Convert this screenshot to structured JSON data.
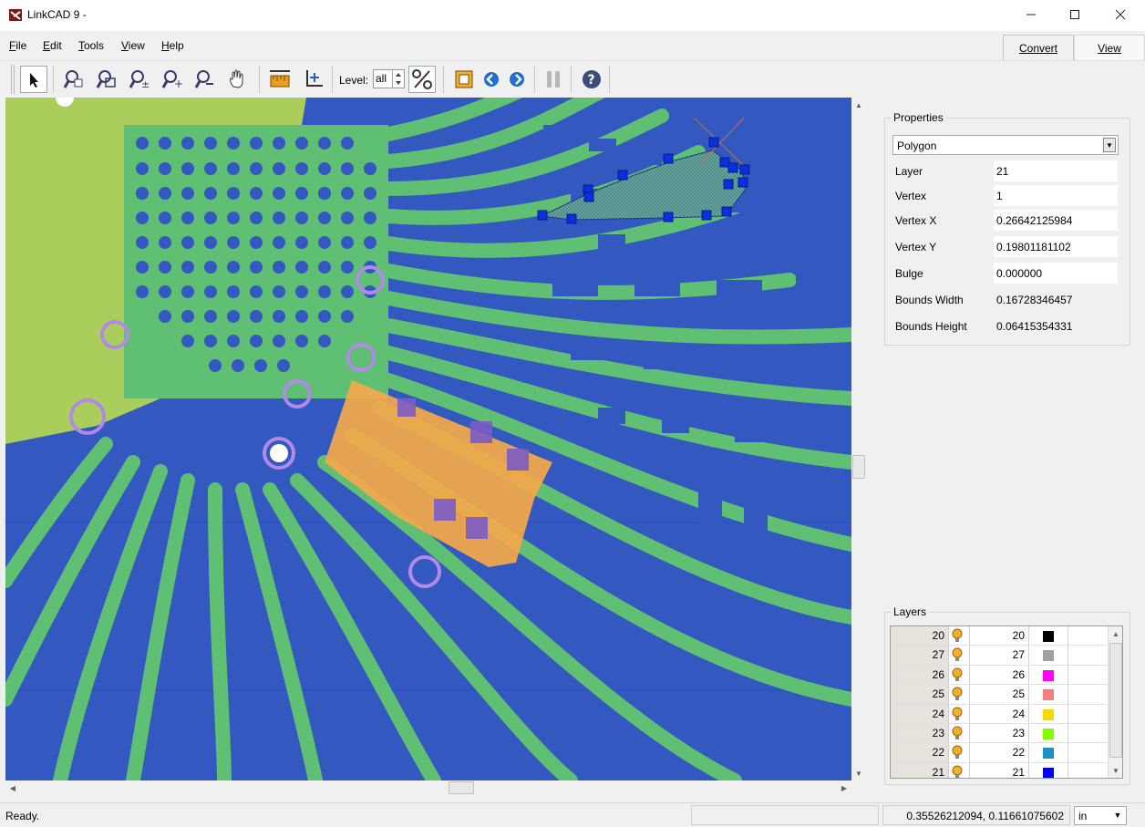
{
  "window": {
    "title": "LinkCAD 9 -"
  },
  "menu": [
    {
      "label": "File",
      "key": "F",
      "rest": "ile"
    },
    {
      "label": "Edit",
      "key": "E",
      "rest": "dit"
    },
    {
      "label": "Tools",
      "key": "T",
      "rest": "ools"
    },
    {
      "label": "View",
      "key": "V",
      "rest": "iew"
    },
    {
      "label": "Help",
      "key": "H",
      "rest": "elp"
    }
  ],
  "tabs": {
    "convert": "Convert",
    "view": "View"
  },
  "toolbar": {
    "level_label": "Level:",
    "level_value": "all",
    "tools": [
      "select-arrow-icon",
      "zoom-window-icon",
      "zoom-fit-icon",
      "zoom-step-icon",
      "zoom-in-icon",
      "zoom-out-icon",
      "pan-hand-icon",
      "measure-icon",
      "origin-icon",
      "percent-icon",
      "layer-frame-icon",
      "back-icon",
      "forward-icon",
      "pause-icon",
      "help-icon"
    ]
  },
  "properties": {
    "title": "Properties",
    "type": "Polygon",
    "rows": [
      {
        "label": "Layer",
        "value": "21",
        "editable": true
      },
      {
        "label": "Vertex",
        "value": "1",
        "editable": true
      },
      {
        "label": "Vertex X",
        "value": "0.26642125984",
        "editable": true
      },
      {
        "label": "Vertex Y",
        "value": "0.19801181102",
        "editable": true
      },
      {
        "label": "Bulge",
        "value": "0.000000",
        "editable": true
      },
      {
        "label": "Bounds Width",
        "value": "0.16728346457",
        "editable": false
      },
      {
        "label": "Bounds Height",
        "value": "0.06415354331",
        "editable": false
      }
    ]
  },
  "layers": {
    "title": "Layers",
    "rows": [
      {
        "name": "20",
        "number": "20",
        "color": "#000000"
      },
      {
        "name": "27",
        "number": "27",
        "color": "#a0a0a0"
      },
      {
        "name": "26",
        "number": "26",
        "color": "#ff00ff"
      },
      {
        "name": "25",
        "number": "25",
        "color": "#f08080"
      },
      {
        "name": "24",
        "number": "24",
        "color": "#ffd700"
      },
      {
        "name": "23",
        "number": "23",
        "color": "#80ff00"
      },
      {
        "name": "22",
        "number": "22",
        "color": "#1e90c8"
      },
      {
        "name": "21",
        "number": "21",
        "color": "#0000ff"
      }
    ]
  },
  "status": {
    "text": "Ready.",
    "coords": "0.35526212094, 0.11661075602",
    "unit": "in"
  },
  "colors": {
    "canvas_bg": "#3358bf",
    "trace": "#5fbf72",
    "yellow_layer": "#bfe24a",
    "orange_layer": "#f4a84a",
    "purple_pad": "#7c5cc4"
  }
}
